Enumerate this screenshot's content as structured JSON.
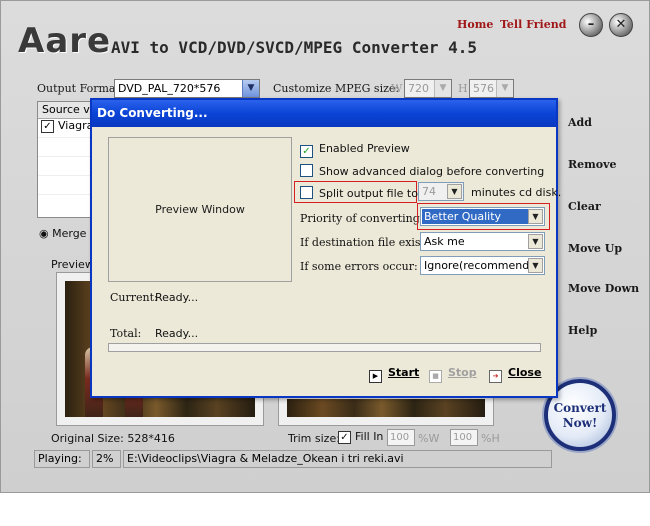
{
  "app": {
    "logo": "Aare",
    "tagline": "AVI to VCD/DVD/SVCD/MPEG Converter 4.5",
    "links": {
      "home": "Home",
      "tell_friend": "Tell Friend"
    },
    "min_glyph": "–",
    "close_glyph": "✕"
  },
  "output": {
    "format_label": "Output Format:",
    "format_value": "DVD_PAL_720*576",
    "mpeg_label": "Customize MPEG size:",
    "w_label": "W",
    "w_value": "720",
    "h_label": "H",
    "h_value": "576"
  },
  "source": {
    "header": "Source vi",
    "items": [
      "Viagra"
    ],
    "merge_label": "Merge a",
    "preview_label": "Preview"
  },
  "sidebar": {
    "add": "Add",
    "remove": "Remove",
    "clear": "Clear",
    "move_up": "Move Up",
    "move_down": "Move Down",
    "help": "Help"
  },
  "convert": {
    "line1": "Convert",
    "line2": "Now!"
  },
  "bottom": {
    "original_size": "Original Size: 528*416",
    "trim_label": "Trim size:",
    "fill_in": "Fill In",
    "trim_w": "100",
    "trim_w_unit": "%W",
    "trim_h": "100",
    "trim_h_unit": "%H"
  },
  "status": {
    "playing": "Playing:",
    "percent": "2%",
    "file": "E:\\Videoclips\\Viagra & Meladze_Okean i tri reki.avi"
  },
  "dialog": {
    "title": "Do Converting...",
    "preview_window": "Preview Window",
    "enabled_preview": "Enabled Preview",
    "show_advanced": "Show advanced dialog before converting",
    "split_label": "Split output file to fit",
    "split_value": "74",
    "split_suffix": "minutes cd disk.",
    "priority_label": "Priority of converting:",
    "priority_value": "Better Quality",
    "exists_label": "If destination file exists:",
    "exists_value": "Ask me",
    "errors_label": "If some errors occur:",
    "errors_value": "Ignore(recommended)",
    "current_label": "Current:",
    "current_value": "Ready...",
    "total_label": "Total:",
    "total_value": "Ready...",
    "start": "Start",
    "stop": "Stop",
    "close": "Close"
  }
}
